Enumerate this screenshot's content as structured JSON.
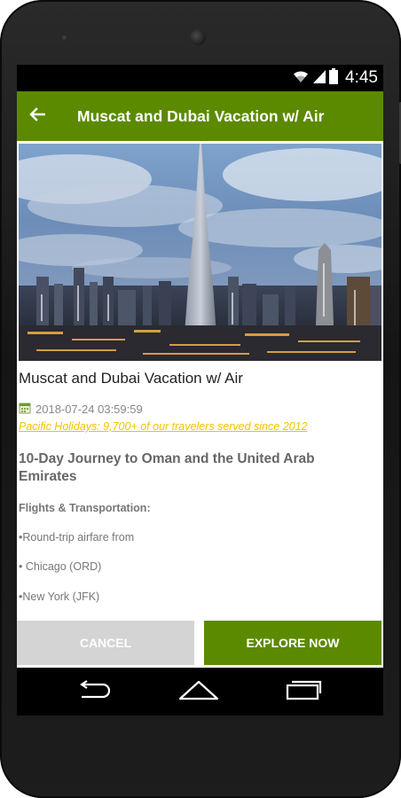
{
  "status_bar": {
    "time": "4:45",
    "icons": [
      "wifi-icon",
      "signal-icon",
      "battery-icon"
    ]
  },
  "toolbar": {
    "back_icon": "arrow-left-icon",
    "title": "Muscat and Dubai Vacation w/ Air",
    "color": "#5b8a00"
  },
  "hero": {
    "image": "dubai-skyline-photo"
  },
  "article": {
    "title": "Muscat and Dubai Vacation w/ Air",
    "date_icon": "calendar-icon",
    "date": "2018-07-24 03:59:59",
    "promo_link": "Pacific Holidays: 9,700+ of our travelers served since 2012",
    "subheading": "10-Day Journey to Oman and the United Arab Emirates",
    "section_label": "Flights & Transportation:",
    "lines": [
      "•Round-trip airfare from",
      "• Chicago (ORD)",
      "•New York (JFK)"
    ]
  },
  "buttons": {
    "cancel": "CANCEL",
    "explore": "EXPLORE NOW"
  },
  "nav": {
    "back": "back-icon",
    "home": "home-icon",
    "recents": "recents-icon"
  },
  "colors": {
    "accent": "#5b8a00",
    "link": "#f0c400",
    "cancel_bg": "#d4d4d4"
  }
}
